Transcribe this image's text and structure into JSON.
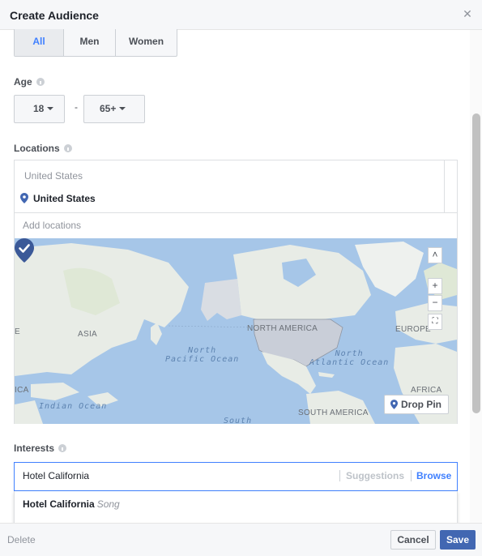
{
  "dialog": {
    "title": "Create Audience",
    "close_icon": "close-icon"
  },
  "gender": {
    "options": [
      "All",
      "Men",
      "Women"
    ],
    "selected": "All"
  },
  "age": {
    "label": "Age",
    "min": "18",
    "dash": "-",
    "max": "65+"
  },
  "locations": {
    "label": "Locations",
    "country_header": "United States",
    "selected_item": "United States",
    "add_placeholder": "Add locations"
  },
  "map": {
    "labels": {
      "asia": "ASIA",
      "north_america": "NORTH AMERICA",
      "europe": "EUROPE",
      "africa": "AFRICA",
      "south_america": "SOUTH AMERICA",
      "ica": "ICA",
      "e_edge": "E",
      "north_pacific": "North\nPacific Ocean",
      "north_atlantic": "North\nAtlantic Ocean",
      "indian_ocean": "Indian Ocean",
      "south": "South"
    },
    "controls": {
      "up": "˄",
      "zoom_in": "+",
      "zoom_out": "−",
      "fullscreen": "⛶"
    },
    "drop_pin_label": "Drop Pin"
  },
  "interests": {
    "label": "Interests",
    "input_value": "Hotel California",
    "suggestions_label": "Suggestions",
    "browse_label": "Browse",
    "results": [
      {
        "name": "Hotel California",
        "type": "Song"
      }
    ]
  },
  "footer": {
    "delete_label": "Delete",
    "cancel_label": "Cancel",
    "save_label": "Save"
  },
  "colors": {
    "accent": "#4080ff",
    "save_bg": "#4267b2",
    "pin": "#4267b2"
  }
}
